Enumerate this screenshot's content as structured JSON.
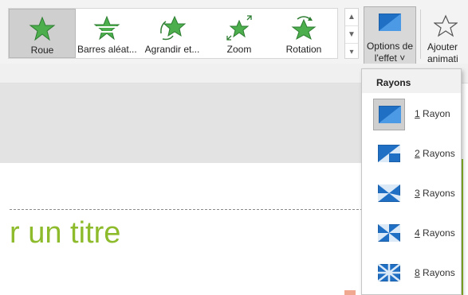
{
  "gallery": {
    "items": [
      {
        "label": "Roue",
        "icon": "star-wheel-icon",
        "selected": true
      },
      {
        "label": "Barres aléat...",
        "icon": "star-random-bars-icon",
        "selected": false
      },
      {
        "label": "Agrandir et...",
        "icon": "star-grow-turn-icon",
        "selected": false
      },
      {
        "label": "Zoom",
        "icon": "star-zoom-icon",
        "selected": false
      },
      {
        "label": "Rotation",
        "icon": "star-rotation-icon",
        "selected": false
      }
    ]
  },
  "effect_options": {
    "line1": "Options de",
    "line2": "l'effet ˅"
  },
  "add_animation": {
    "line1": "Ajouter",
    "line2": "animati"
  },
  "slide": {
    "title_fragment": "r un titre"
  },
  "dropdown": {
    "header": "Rayons",
    "items": [
      {
        "key": "1",
        "rest": " Rayon",
        "selected": true
      },
      {
        "key": "2",
        "rest": " Rayons",
        "selected": false
      },
      {
        "key": "3",
        "rest": " Rayons",
        "selected": false
      },
      {
        "key": "4",
        "rest": " Rayons",
        "selected": false
      },
      {
        "key": "8",
        "rest": " Rayons",
        "selected": false
      }
    ]
  },
  "colors": {
    "accent_green": "#8dbb2b",
    "star_green": "#4cae4c",
    "icon_blue": "#1f6fc4"
  }
}
